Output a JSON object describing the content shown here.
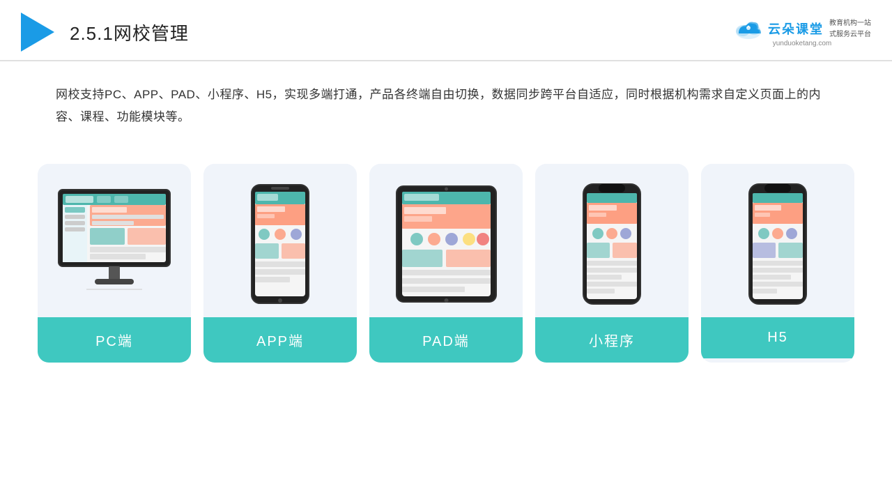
{
  "header": {
    "title_prefix": "2.5.1",
    "title_main": "网校管理",
    "brand_name": "云朵课堂",
    "brand_url": "yunduoketang.com",
    "brand_tagline_line1": "教育机构一站",
    "brand_tagline_line2": "式服务云平台"
  },
  "description": "网校支持PC、APP、PAD、小程序、H5，实现多端打通，产品各终端自由切换，数据同步跨平台自适应，同时根据机构需求自定义页面上的内容、课程、功能模块等。",
  "cards": [
    {
      "label": "PC端",
      "type": "pc"
    },
    {
      "label": "APP端",
      "type": "phone"
    },
    {
      "label": "PAD端",
      "type": "tablet"
    },
    {
      "label": "小程序",
      "type": "phone_notch"
    },
    {
      "label": "H5",
      "type": "phone_notch2"
    }
  ],
  "accent_color": "#3fc8c0"
}
